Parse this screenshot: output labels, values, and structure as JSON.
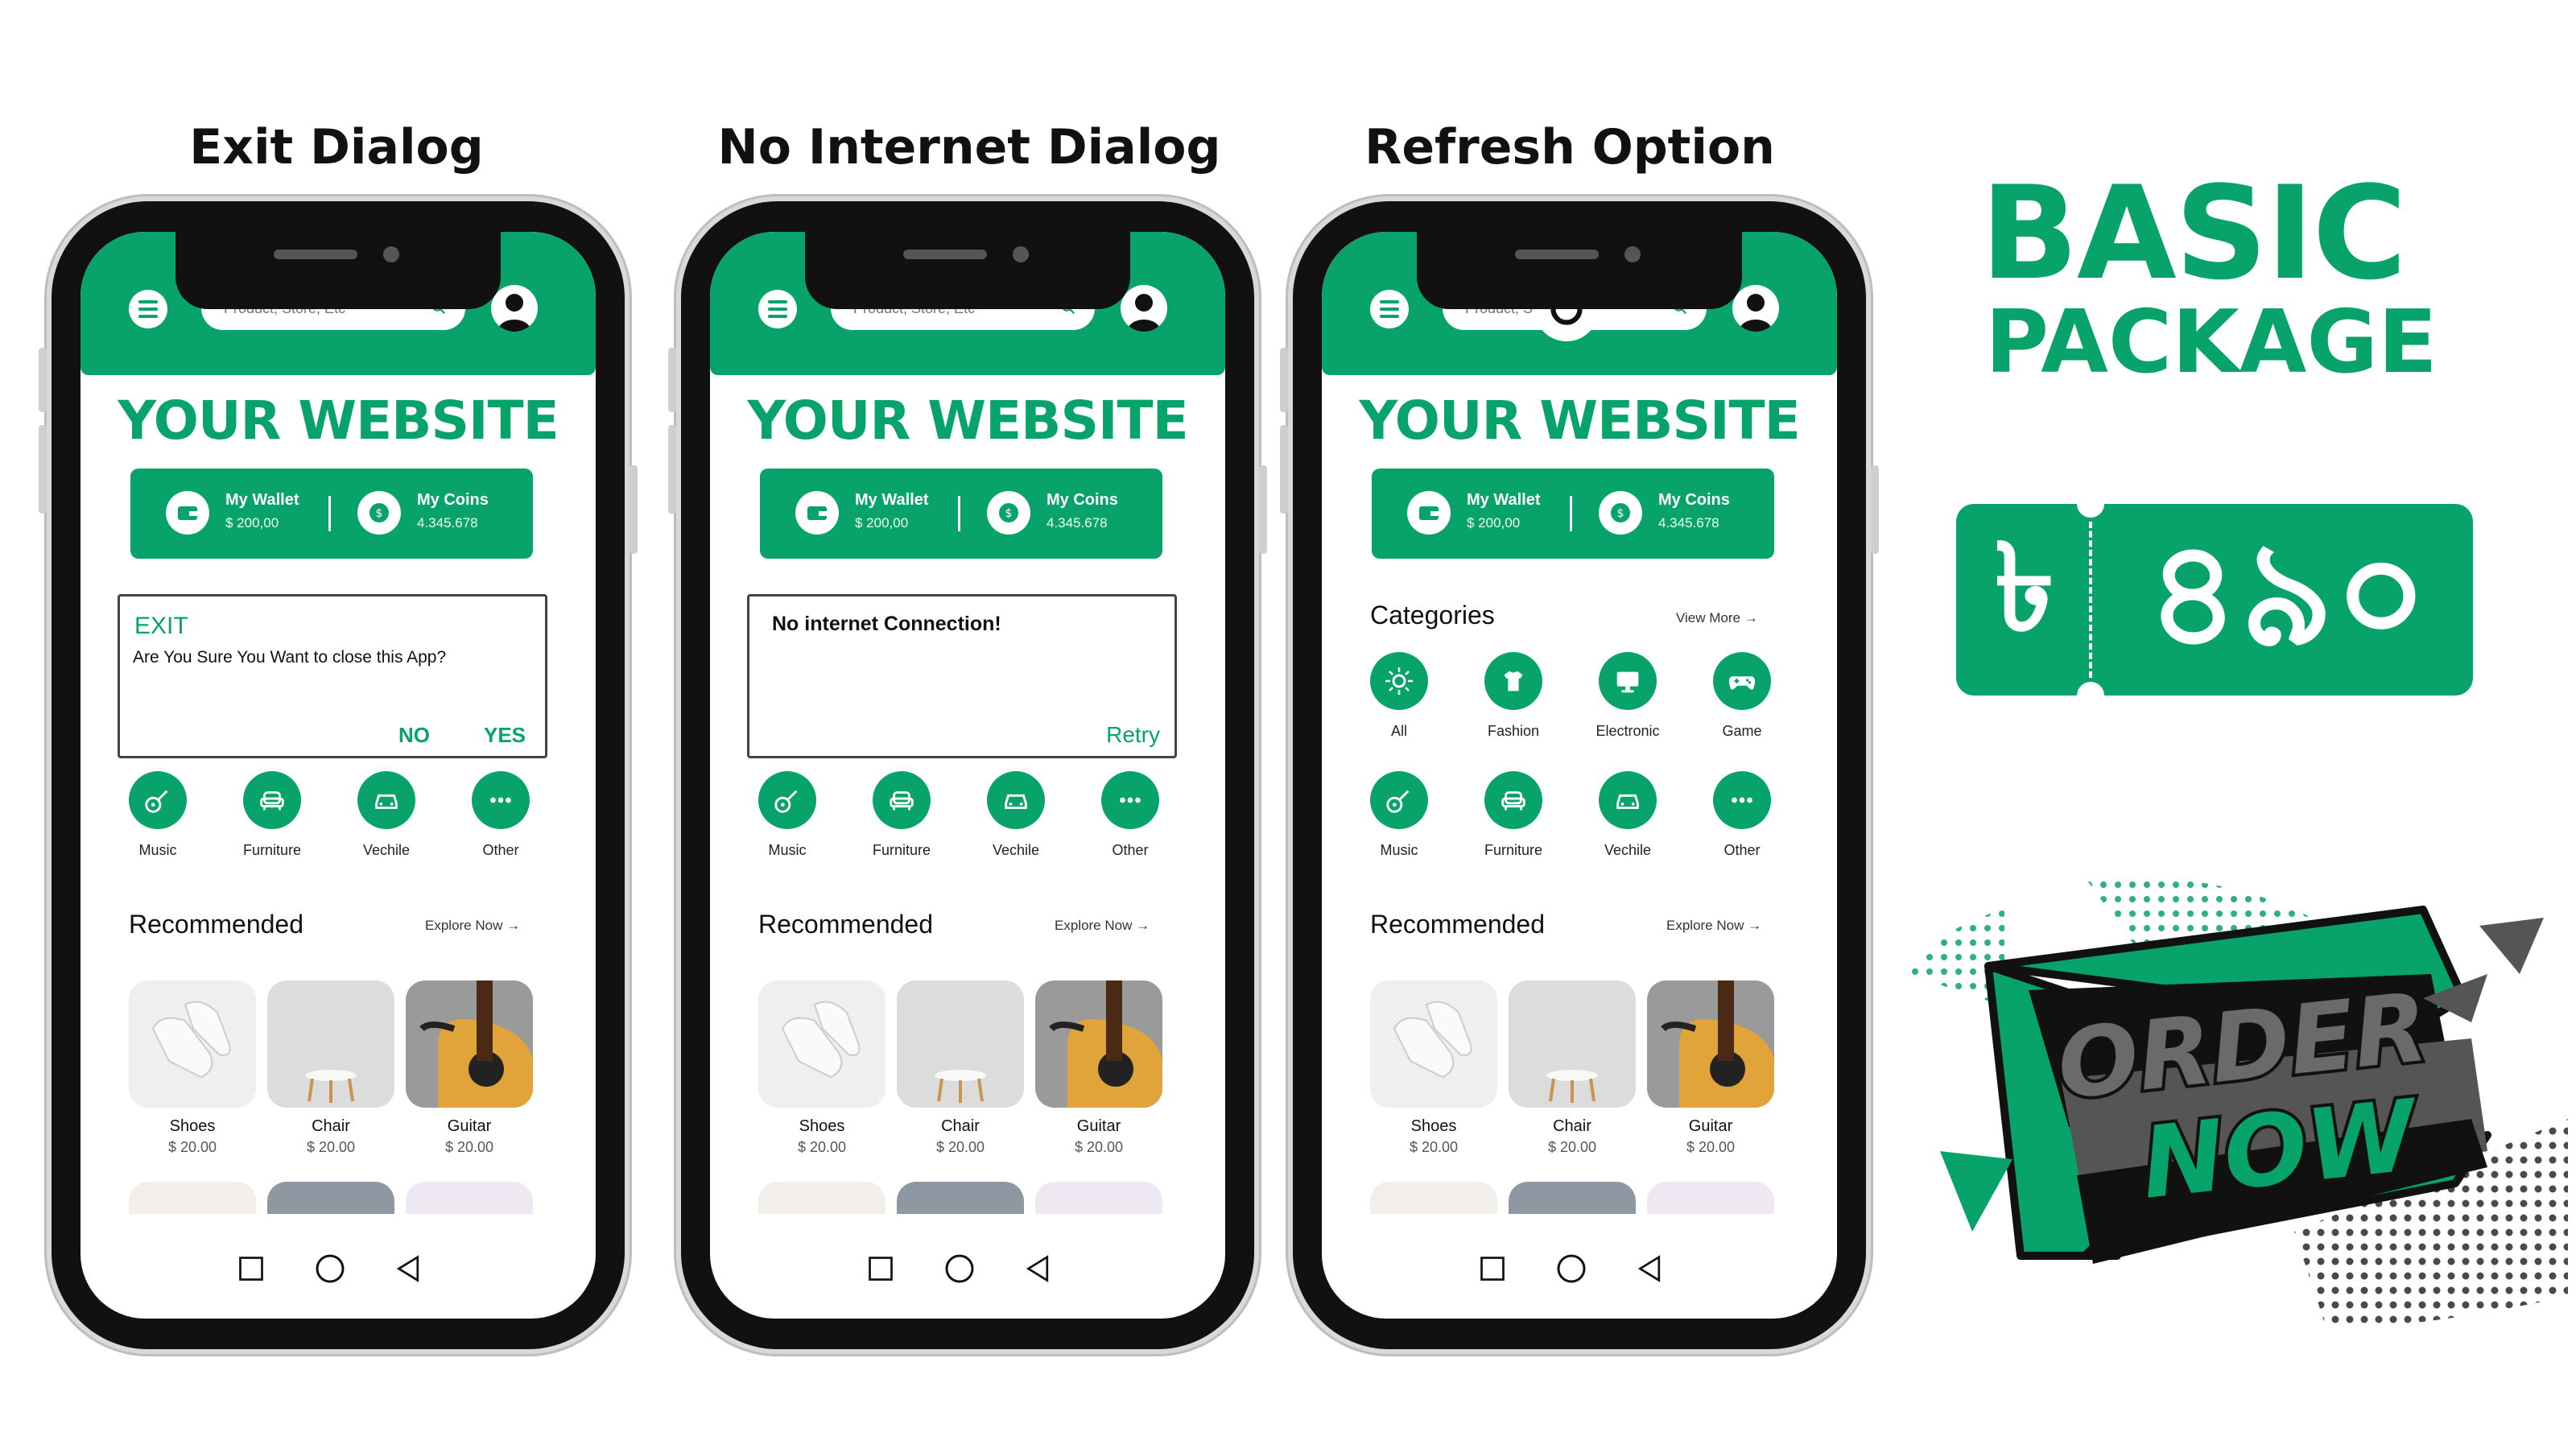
{
  "columns": [
    {
      "title": "Exit Dialog",
      "variant": "exit"
    },
    {
      "title": "No Internet Dialog",
      "variant": "no_internet"
    },
    {
      "title": "Refresh Option",
      "variant": "refresh"
    }
  ],
  "app": {
    "search_placeholder": "Product, Store, Etc",
    "search_placeholder_short": "Product, S",
    "site_title": "YOUR WEBSITE",
    "wallet": {
      "wallet_label": "My Wallet",
      "wallet_value": "$ 200,00",
      "coins_label": "My Coins",
      "coins_value": "4.345.678"
    },
    "categories": {
      "header": "Categories",
      "view_more": "View More",
      "row1": [
        "All",
        "Fashion",
        "Electronic",
        "Game"
      ],
      "row2": [
        "Music",
        "Furniture",
        "Vechile",
        "Other"
      ]
    },
    "recommended": {
      "header": "Recommended",
      "explore": "Explore Now",
      "products": [
        {
          "name": "Shoes",
          "price": "$ 20.00"
        },
        {
          "name": "Chair",
          "price": "$ 20.00"
        },
        {
          "name": "Guitar",
          "price": "$ 20.00"
        }
      ]
    }
  },
  "exit_dialog": {
    "title": "EXIT",
    "message": "Are You Sure You Want to close this App?",
    "no": "NO",
    "yes": "YES"
  },
  "no_internet_dialog": {
    "message": "No internet Connection!",
    "retry": "Retry"
  },
  "promo": {
    "line1": "BASIC",
    "line2": "PACKAGE",
    "currency_symbol": "৳",
    "price": "৪৯০",
    "order_line1": "ORDER",
    "order_line2": "NOW"
  },
  "colors": {
    "brand_green": "#08a36b",
    "dark": "#111111",
    "order_gray": "#5a5a5a"
  }
}
